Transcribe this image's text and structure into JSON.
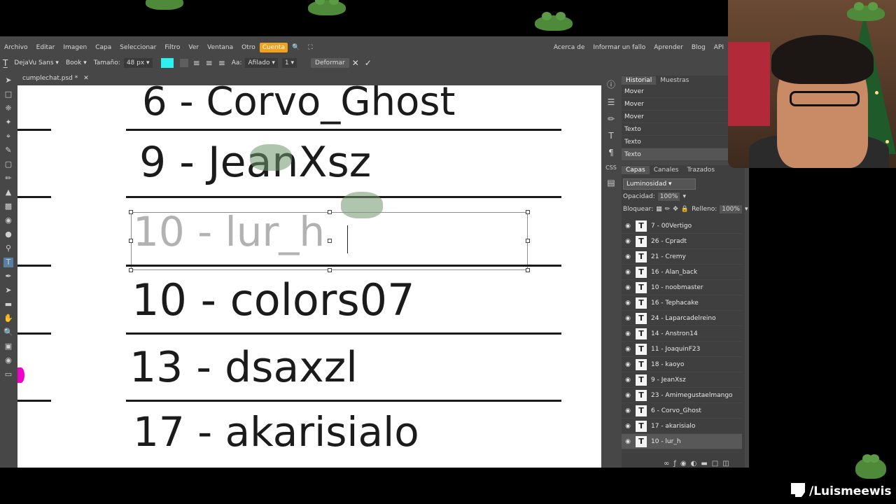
{
  "menu": {
    "items": [
      "Archivo",
      "Editar",
      "Imagen",
      "Capa",
      "Seleccionar",
      "Filtro",
      "Ver",
      "Ventana",
      "Otro",
      "Cuenta"
    ],
    "right_items": [
      "Acerca de",
      "Informar un fallo",
      "Aprender",
      "Blog",
      "API"
    ]
  },
  "options": {
    "font": "DejaVu Sans",
    "style": "Book",
    "size_label": "Tamaño:",
    "size_value": "48 px",
    "aa_label": "Aa:",
    "aa_value": "Afilado",
    "line_value": "1",
    "deform_label": "Deformar",
    "text_color": "#2df0f0"
  },
  "document": {
    "tab": "cumplechat.psd *"
  },
  "canvas": {
    "rows": [
      "6 - Corvo_Ghost",
      "9 - JeanXsz",
      "10 - lur_h",
      "10 - colors07",
      "13 - dsaxzl",
      "17 - akarisialo"
    ],
    "editing_row": "10 - lur_h"
  },
  "history": {
    "tabs": [
      "Historial",
      "Muestras"
    ],
    "items": [
      "Mover",
      "Mover",
      "Mover",
      "Texto",
      "Texto",
      "Texto"
    ]
  },
  "layers": {
    "tabs": [
      "Capas",
      "Canales",
      "Trazados"
    ],
    "blend_mode": "Luminosidad",
    "opacity_label": "Opacidad:",
    "opacity_value": "100%",
    "lock_label": "Bloquear:",
    "fill_label": "Relleno:",
    "fill_value": "100%",
    "items": [
      "7 - 00Vertigo",
      "26 - Cpradt",
      "21 - Cremy",
      "16 - Alan_back",
      "10 - noobmaster",
      "16 - Tephacake",
      "24 - Laparcadelreino",
      "14 - Anstron14",
      "11 - JoaquinF23",
      "18 - kaoyo",
      "9 - JeanXsz",
      "23 - Amimegustaelmango",
      "6 - Corvo_Ghost",
      "17 - akarisialo",
      "10 - lur_h"
    ],
    "selected": "10 - lur_h"
  },
  "stream": {
    "handle": "/Luismeewis"
  }
}
